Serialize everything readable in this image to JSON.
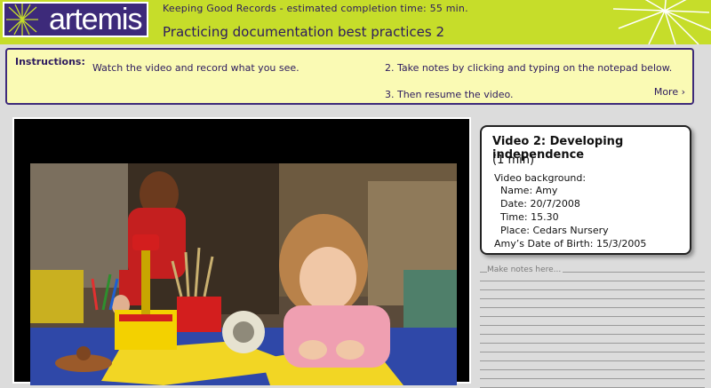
{
  "brand": {
    "logo_text": "artemis"
  },
  "header": {
    "subtitle": "Keeping Good Records - estimated completion time: 55 min.",
    "title": "Practicing documentation best practices 2"
  },
  "instructions": {
    "label": "Instructions:",
    "step1": "Watch the video and record what you see.",
    "step2": "2.  Take notes by clicking and typing on the notepad below.",
    "step3": "3.  Then resume the video.",
    "more": "More ›"
  },
  "video_info": {
    "title": "Video 2: Developing independence",
    "duration": "(1 min)",
    "background_label": "Video background:",
    "name": "Name: Amy",
    "date": "Date: 20/7/2008",
    "time": "Time: 15.30",
    "place": "Place: Cedars Nursery",
    "dob": "Amy’s Date of Birth: 15/3/2005"
  },
  "notepad": {
    "placeholder": "Make notes here..."
  },
  "colors": {
    "header_green": "#c6dd2a",
    "brand_purple": "#3d2a7a",
    "instructions_yellow": "#fafab4",
    "page_gray": "#dcdcdc"
  }
}
